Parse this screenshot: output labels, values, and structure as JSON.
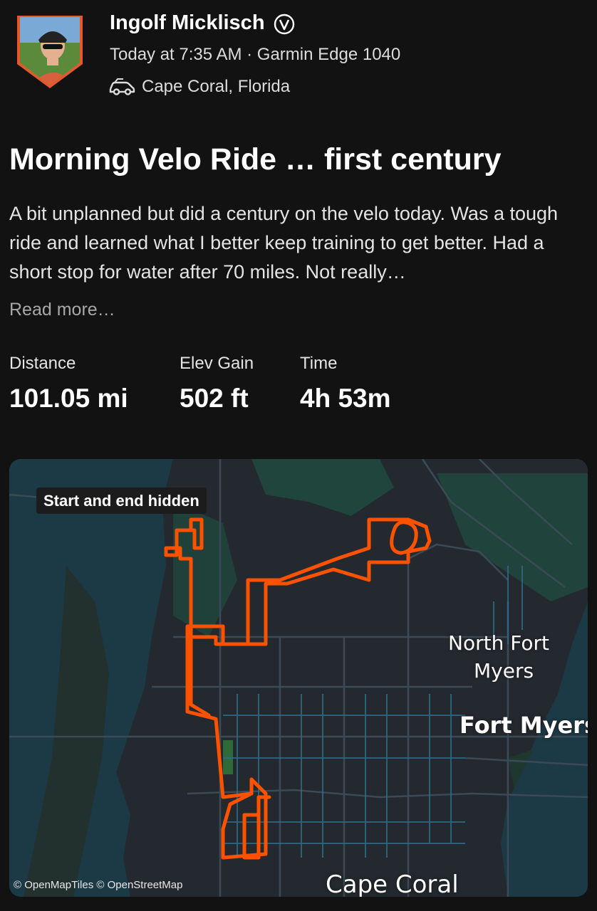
{
  "athlete": {
    "name": "Ingolf Micklisch",
    "verified_glyph": "V",
    "meta": "Today at 7:35 AM · Garmin Edge 1040",
    "location": "Cape Coral, Florida",
    "location_icon": "bike-car-icon"
  },
  "activity": {
    "title": "Morning Velo Ride … first century",
    "description": "A bit unplanned but did a century on the velo today. Was a tough ride and learned what I better keep training to get better. Had a short stop for water after 70 miles.  Not really…",
    "read_more": "Read more…"
  },
  "stats": [
    {
      "label": "Distance",
      "value": "101.05 mi"
    },
    {
      "label": "Elev Gain",
      "value": "502 ft"
    },
    {
      "label": "Time",
      "value": "4h 53m"
    }
  ],
  "map": {
    "badge": "Start and end hidden",
    "labels": {
      "north_fort_myers_line1": "North Fort",
      "north_fort_myers_line2": "Myers",
      "fort_myers": "Fort Myers",
      "cape_coral": "Cape Coral"
    },
    "attribution": "© OpenMapTiles © OpenStreetMap",
    "route_color": "#fc5200",
    "water_color": "#1b3a45",
    "land_color": "#24292f"
  }
}
